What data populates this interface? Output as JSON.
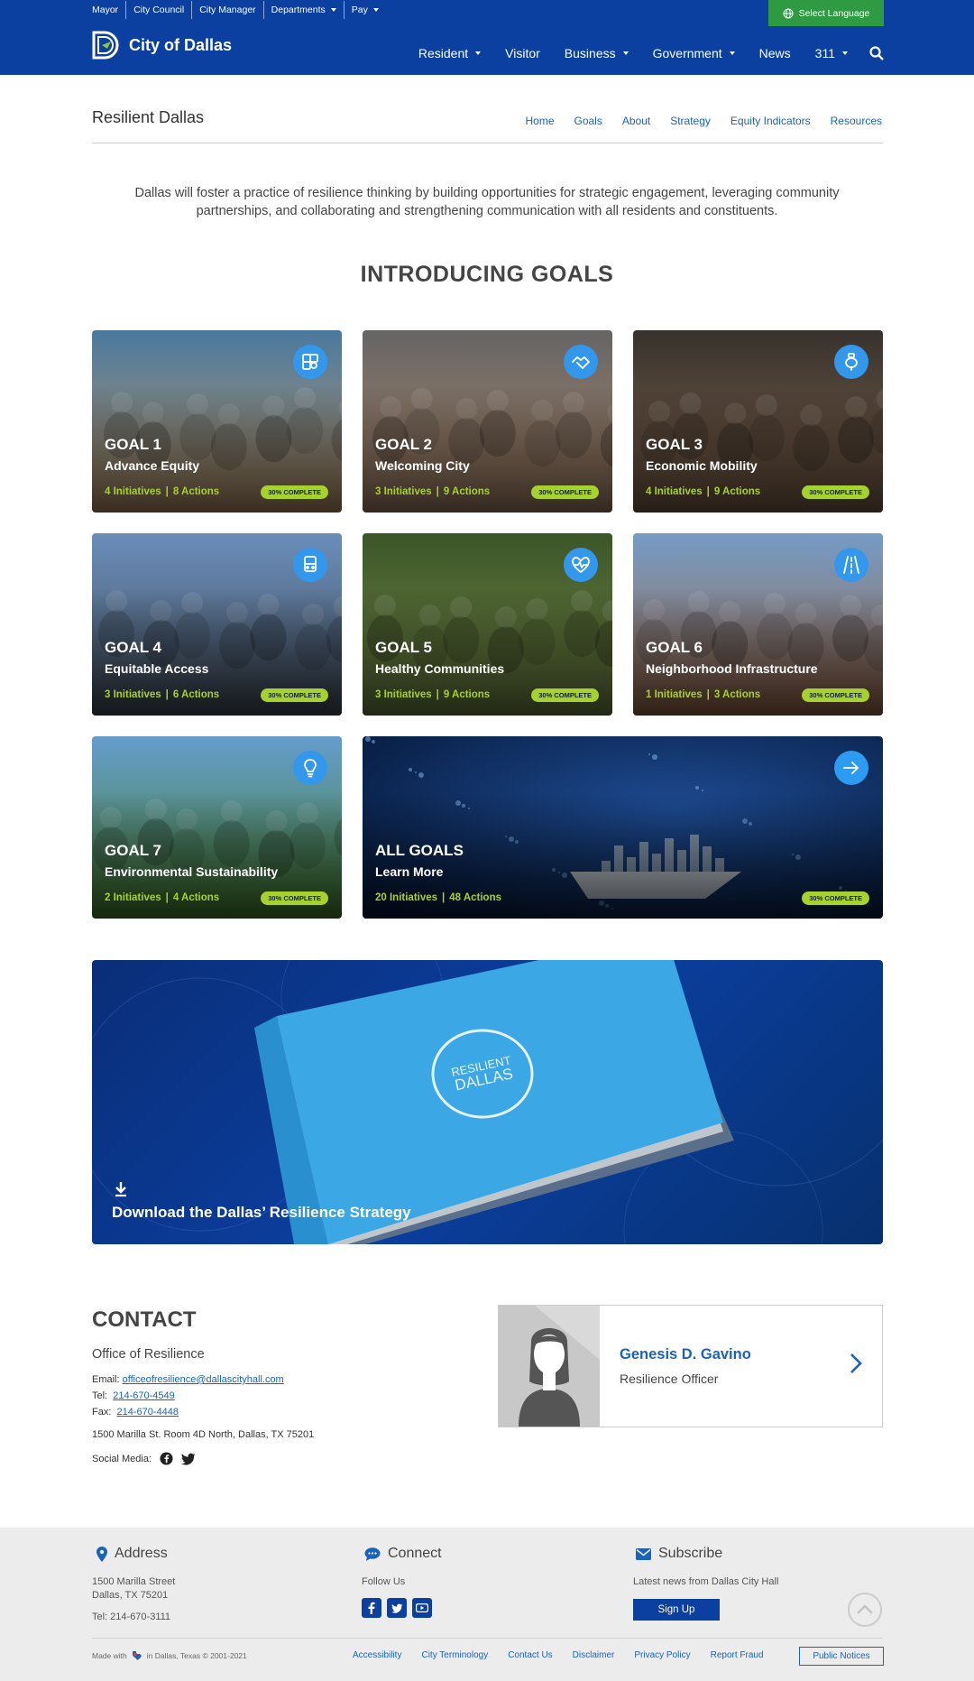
{
  "header": {
    "utility_links": [
      {
        "label": "Mayor",
        "dropdown": false
      },
      {
        "label": "City Council",
        "dropdown": false
      },
      {
        "label": "City Manager",
        "dropdown": false
      },
      {
        "label": "Departments",
        "dropdown": true
      },
      {
        "label": "Pay",
        "dropdown": true
      }
    ],
    "language_button": "Select Language",
    "logo_text": "City of Dallas",
    "nav": [
      {
        "label": "Resident",
        "dropdown": true
      },
      {
        "label": "Visitor",
        "dropdown": false
      },
      {
        "label": "Business",
        "dropdown": true
      },
      {
        "label": "Government",
        "dropdown": true
      },
      {
        "label": "News",
        "dropdown": false
      },
      {
        "label": "311",
        "dropdown": true
      }
    ],
    "brand_color": "#0b3fa0"
  },
  "subnav": {
    "title": "Resilient Dallas",
    "links": [
      "Home",
      "Goals",
      "About",
      "Strategy",
      "Equity Indicators",
      "Resources"
    ]
  },
  "intro": "Dallas will foster a practice of resilience thinking by building opportunities for strategic engagement, leveraging community partnerships, and collaborating and strengthening communication with all residents and constituents.",
  "goals_heading": "INTRODUCING GOALS",
  "goals": [
    {
      "label": "GOAL 1",
      "name": "Advance Equity",
      "initiatives": "4 Initiatives",
      "actions": "8 Actions",
      "status": "30% COMPLETE",
      "icon": "puzzle-icon",
      "palette": [
        "#4e7fa6",
        "#c8a070"
      ]
    },
    {
      "label": "GOAL 2",
      "name": "Welcoming City",
      "initiatives": "3 Initiatives",
      "actions": "9 Actions",
      "status": "30% COMPLETE",
      "icon": "handshake-icon",
      "palette": [
        "#6a6a6a",
        "#b89070"
      ]
    },
    {
      "label": "GOAL 3",
      "name": "Economic Mobility",
      "initiatives": "4 Initiatives",
      "actions": "9 Actions",
      "status": "30% COMPLETE",
      "icon": "piggy-bank-icon",
      "palette": [
        "#3a3530",
        "#8a6a50"
      ]
    },
    {
      "label": "GOAL 4",
      "name": "Equitable Access",
      "initiatives": "3 Initiatives",
      "actions": "6 Actions",
      "status": "30% COMPLETE",
      "icon": "bus-icon",
      "palette": [
        "#6f95c4",
        "#4a5460"
      ]
    },
    {
      "label": "GOAL 5",
      "name": "Healthy Communities",
      "initiatives": "3 Initiatives",
      "actions": "9 Actions",
      "status": "30% COMPLETE",
      "icon": "heartbeat-icon",
      "palette": [
        "#3f5a2a",
        "#7a8f4a"
      ]
    },
    {
      "label": "GOAL 6",
      "name": "Neighborhood Infrastructure",
      "initiatives": "1 Initiatives",
      "actions": "3 Actions",
      "status": "30% COMPLETE",
      "icon": "road-icon",
      "palette": [
        "#7ba3cf",
        "#a7704d"
      ]
    },
    {
      "label": "GOAL 7",
      "name": "Environmental Sustainability",
      "initiatives": "2 Initiatives",
      "actions": "4 Actions",
      "status": "30% COMPLETE",
      "icon": "lightbulb-icon",
      "palette": [
        "#6aa4d8",
        "#4c8a2e"
      ]
    }
  ],
  "all_goals": {
    "label": "ALL GOALS",
    "name": "Learn More",
    "initiatives": "20 Initiatives",
    "actions": "48 Actions",
    "status": "30% COMPLETE",
    "icon": "arrow-right-icon"
  },
  "banner": {
    "text": "Download the Dallas’ Resilience Strategy",
    "book_text_line1": "RESILIENT",
    "book_text_line2": "DALLAS"
  },
  "contact": {
    "heading": "CONTACT",
    "office": "Office of Resilience",
    "email_label": "Email:",
    "email": "officeofresilience@dallascityhall.com",
    "tel_label": "Tel:",
    "tel": "214-670-4549",
    "fax_label": "Fax:",
    "fax": "214-670-4448",
    "address": "1500 Marilla St. Room 4D North, Dallas, TX 75201",
    "social_label": "Social Media:",
    "person_name": "Genesis D. Gavino",
    "person_role": "Resilience Officer"
  },
  "footer": {
    "address_heading": "Address",
    "address_line1": "1500 Marilla Street",
    "address_line2": "Dallas, TX 75201",
    "address_tel": "Tel: 214-670-3111",
    "connect_heading": "Connect",
    "follow_us": "Follow Us",
    "subscribe_heading": "Subscribe",
    "subscribe_text": "Latest news from Dallas City Hall",
    "subscribe_button": "Sign Up",
    "made_with_1": "Made with",
    "made_with_2": "in Dallas, Texas © 2001-2021",
    "links": [
      "Accessibility",
      "City Terminology",
      "Contact Us",
      "Disclaimer",
      "Privacy Policy",
      "Report Fraud"
    ],
    "notices_button": "Public Notices"
  }
}
